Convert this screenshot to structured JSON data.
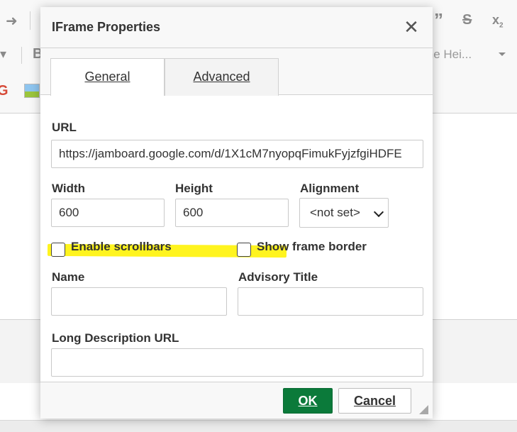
{
  "background": {
    "toolbar_line_height_label": "ine Hei...",
    "toolbar_letter_b": "B",
    "toolbar_g": "G",
    "icons": [
      "redo-icon",
      "quote-icon",
      "strikethrough-icon",
      "subscript-icon",
      "image-icon",
      "google-icon"
    ]
  },
  "dialog": {
    "title": "IFrame Properties",
    "close_symbol": "✕",
    "tabs": [
      {
        "label": "General"
      },
      {
        "label": "Advanced"
      }
    ],
    "url": {
      "label": "URL",
      "value": "https://jamboard.google.com/d/1X1cM7nyopqFimukFyjzfgiHDFE"
    },
    "width": {
      "label": "Width",
      "value": "600"
    },
    "height": {
      "label": "Height",
      "value": "600"
    },
    "alignment": {
      "label": "Alignment",
      "selected": "<not set>"
    },
    "enable_scrollbars": {
      "label": "Enable scrollbars",
      "checked": false
    },
    "show_frame_border": {
      "label": "Show frame border",
      "checked": false
    },
    "name": {
      "label": "Name",
      "value": ""
    },
    "advisory_title": {
      "label": "Advisory Title",
      "value": ""
    },
    "long_description_url": {
      "label": "Long Description URL",
      "value": ""
    },
    "ok_label": "OK",
    "cancel_label": "Cancel"
  },
  "colors": {
    "ok_button": "#0b7a3a",
    "highlight": "#fff200"
  }
}
